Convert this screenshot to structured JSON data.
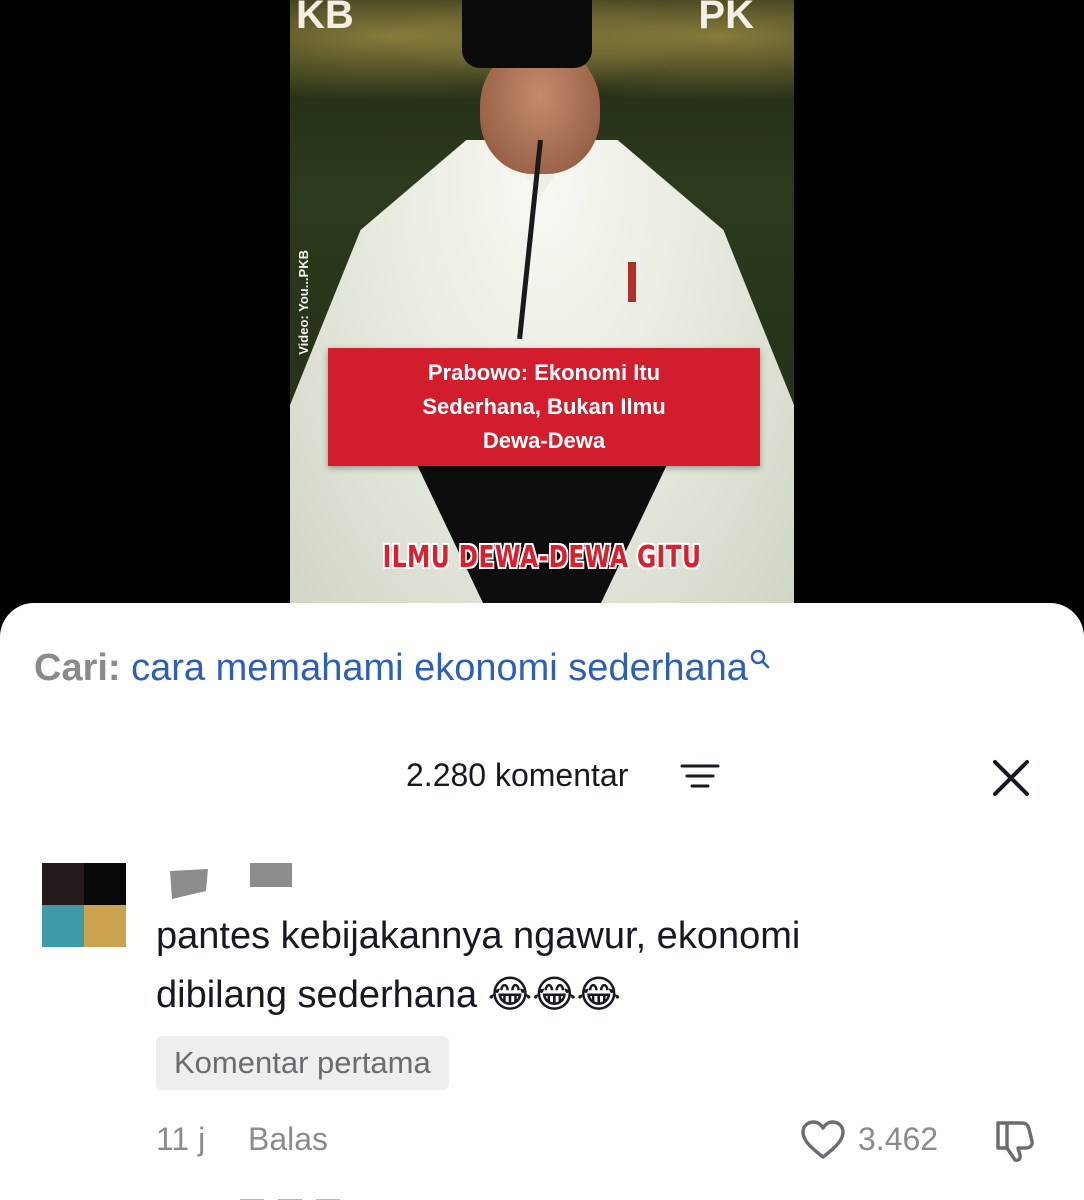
{
  "video": {
    "logo_left": "KB",
    "logo_right": "PK",
    "credit": "Video: You...PKB",
    "caption": "Prabowo: Ekonomi Itu\nSederhana, Bukan Ilmu\nDewa-Dewa",
    "subtitle": "ILMU DEWA-DEWA GITU"
  },
  "search": {
    "label": "Cari:",
    "query": "cara memahami ekonomi sederhana",
    "icon": "search-icon"
  },
  "comments_header": {
    "count_label": "2.280 komentar",
    "filter_icon": "filter-icon",
    "close_icon": "close-icon"
  },
  "comment": {
    "avatar_colors": [
      "#231c1a",
      "#080808",
      "#3e9aa6",
      "#cba24d"
    ],
    "text": "pantes kebijakannya ngawur, ekonomi\ndibilang sederhana ",
    "emoji": "😂😂😂",
    "tag": "Komentar pertama",
    "time": "11 j",
    "reply_label": "Balas",
    "like_count": "3.462",
    "like_icon": "heart-icon",
    "dislike_icon": "thumbs-down-icon"
  },
  "colors": {
    "caption_red": "#d11d2c",
    "search_link": "#2b5fb8",
    "text_primary": "#161823",
    "text_secondary": "#8a8b91"
  }
}
